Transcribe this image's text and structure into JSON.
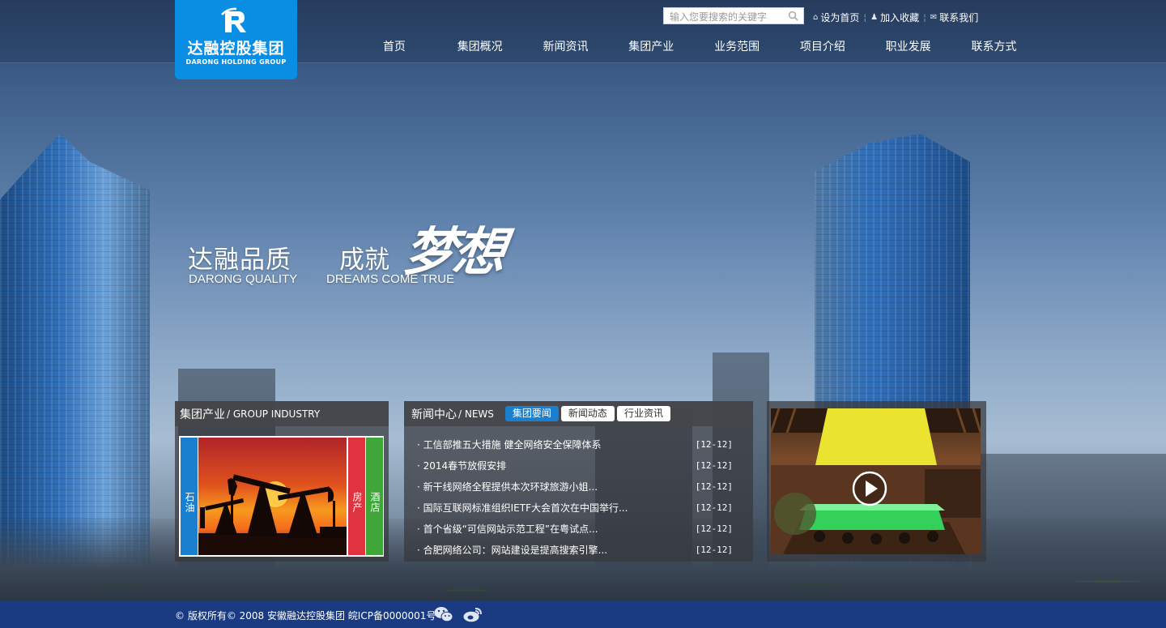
{
  "brand": {
    "name_cn": "达融控股集团",
    "name_en": "DARONG HOLDING GROUP",
    "accent_color": "#0a8ee3"
  },
  "header": {
    "search_placeholder": "输入您要搜索的关键字",
    "links": [
      {
        "icon": "home-icon",
        "label": "设为首页"
      },
      {
        "icon": "bookmark-icon",
        "label": "加入收藏"
      },
      {
        "icon": "mail-icon",
        "label": "联系我们"
      }
    ],
    "nav": [
      "首页",
      "集团概况",
      "新闻资讯",
      "集团产业",
      "业务范围",
      "项目介绍",
      "职业发展",
      "联系方式"
    ]
  },
  "slogan": {
    "cn1": "达融品质",
    "cn2": "成就",
    "script": "梦想",
    "en1": "DARONG QUALITY",
    "en2": "DREAMS COME TRUE"
  },
  "industry": {
    "title_cn": "集团产业",
    "title_en": "/ GROUP INDUSTRY",
    "tabs": [
      {
        "label": "石油",
        "color": "#1a7fcf"
      },
      {
        "label": "房产",
        "color": "#e03340"
      },
      {
        "label": "酒店",
        "color": "#3fa63a"
      }
    ]
  },
  "news": {
    "title_cn": "新闻中心",
    "title_en": "/ NEWS",
    "tabs": [
      "集团要闻",
      "新闻动态",
      "行业资讯"
    ],
    "active_tab": 0,
    "items": [
      {
        "title": "· 工信部推五大措施 健全网络安全保障体系",
        "date": "[12-12]"
      },
      {
        "title": "· 2014春节放假安排",
        "date": "[12-12]"
      },
      {
        "title": "· 新干线网络全程提供本次环球旅游小姐...",
        "date": "[12-12]"
      },
      {
        "title": "· 国际互联网标准组织IETF大会首次在中国举行...",
        "date": "[12-12]"
      },
      {
        "title": "· 首个省级“可信网站示范工程”在粤试点...",
        "date": "[12-12]"
      },
      {
        "title": "· 合肥网络公司：网站建设是提高搜索引擎...",
        "date": "[12-12]"
      }
    ]
  },
  "video": {
    "icon": "play-icon"
  },
  "footer": {
    "copyright": "© 版权所有© 2008 安徽融达控股集团 皖ICP备0000001号",
    "social": [
      "wechat-icon",
      "weibo-icon"
    ]
  }
}
